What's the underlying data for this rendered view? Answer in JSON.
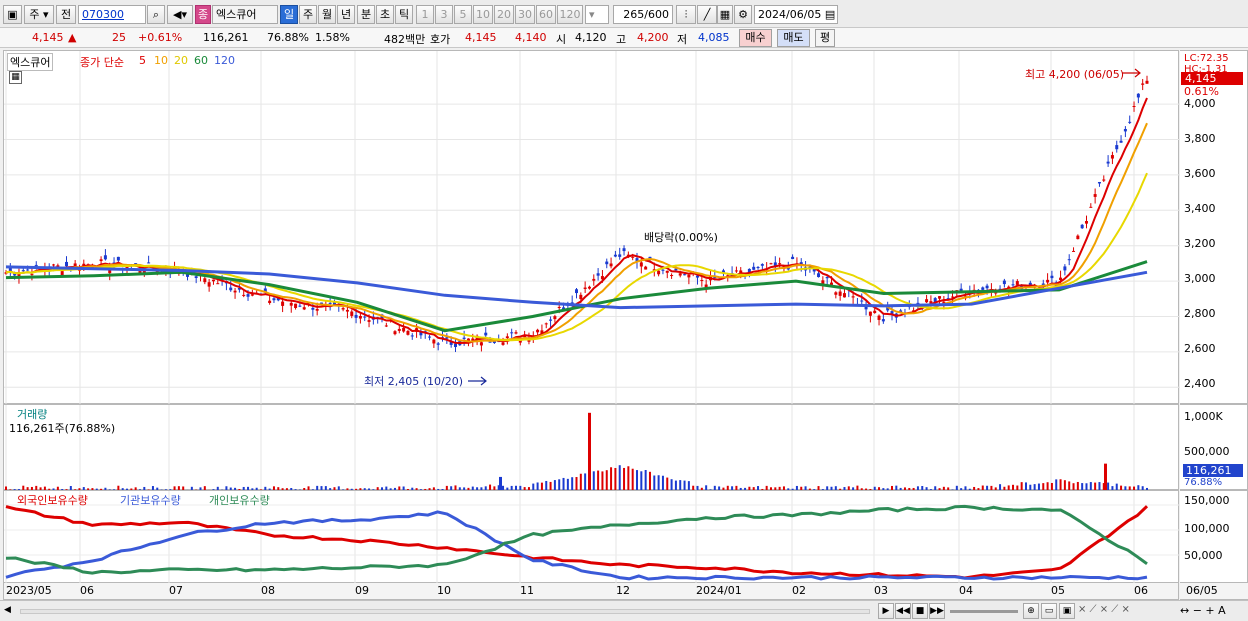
{
  "toolbar": {
    "mode1": "주",
    "mode2": "전",
    "code": "070300",
    "name": "엑스큐어",
    "name_badge": "종",
    "periods": [
      "일",
      "주",
      "월",
      "년",
      "분",
      "초",
      "틱"
    ],
    "intervals": [
      "1",
      "3",
      "5",
      "10",
      "20",
      "30",
      "60",
      "120"
    ],
    "count": "265",
    "count_total": "/600",
    "date": "2024/06/05"
  },
  "quote": {
    "price": "4,145",
    "arrow": "▲",
    "change": "25",
    "pct": "+0.61%",
    "volume": "116,261",
    "vol_ratio": "76.88%",
    "turnover": "1.58%",
    "value": "482백만",
    "hoga_label": "호가",
    "ask": "4,145",
    "bid": "4,140",
    "open_label": "시",
    "open": "4,120",
    "high_label": "고",
    "high": "4,200",
    "low_label": "저",
    "low": "4,085",
    "buy": "매수",
    "sell": "매도",
    "eval": "평"
  },
  "price_panel": {
    "name": "엑스큐어",
    "ma_label": "종가 단순",
    "ma_periods": [
      "5",
      "10",
      "20",
      "60",
      "120"
    ],
    "ma_colors": [
      "#dd0000",
      "#f0a000",
      "#e8d800",
      "#1a8a3a",
      "#3a5ad8"
    ],
    "high_note": "최고 4,200 (06/05)",
    "low_note": "최저 2,405 (10/20)",
    "div_note": "배당락(0.00%)",
    "lc": "LC:72.35",
    "hc": "HC:-1.31",
    "price_tag": "4,145",
    "pct_tag": "0.61%",
    "y_ticks": [
      "4,000",
      "3,800",
      "3,600",
      "3,400",
      "3,200",
      "3,000",
      "2,800",
      "2,600",
      "2,400"
    ]
  },
  "volume_panel": {
    "title": "거래량",
    "info": "116,261주(76.88%)",
    "y_ticks": [
      "1,000K",
      "500,000"
    ],
    "tag": "116,261",
    "tag2": "76.88%"
  },
  "holding_panel": {
    "s1": "외국인보유수량",
    "s2": "기관보유수량",
    "s3": "개인보유수량",
    "colors": [
      "#dd0000",
      "#3a5ad8",
      "#2e8b57"
    ],
    "y_ticks": [
      "150,000",
      "100,000",
      "50,000"
    ]
  },
  "x_axis": [
    "2023/05",
    "06",
    "07",
    "08",
    "09",
    "10",
    "11",
    "12",
    "2024/01",
    "02",
    "03",
    "04",
    "05",
    "06"
  ],
  "x_axis_right": "06/05",
  "chart_data": {
    "type": "line",
    "title": "엑스큐어 (070300)",
    "x": [
      "2023/05",
      "06",
      "07",
      "08",
      "09",
      "10",
      "11",
      "12",
      "2024/01",
      "02",
      "03",
      "04",
      "05",
      "06"
    ],
    "series": [
      {
        "name": "종가",
        "values": [
          3050,
          3100,
          3060,
          2900,
          2820,
          2650,
          2700,
          3150,
          3000,
          3100,
          2800,
          2950,
          3000,
          4145
        ]
      },
      {
        "name": "단순 60",
        "values": [
          3020,
          3030,
          3050,
          2980,
          2880,
          2720,
          2800,
          2900,
          2960,
          3000,
          2930,
          2940,
          2950,
          3110
        ]
      },
      {
        "name": "단순 120",
        "values": [
          3080,
          3070,
          3060,
          3040,
          2990,
          2920,
          2880,
          2850,
          2860,
          2870,
          2860,
          2870,
          2960,
          3050
        ]
      },
      {
        "name": "거래량",
        "values": [
          60000,
          70000,
          40000,
          60000,
          50000,
          65000,
          150000,
          1000000,
          60000,
          70000,
          80000,
          50000,
          350000,
          116261
        ]
      },
      {
        "name": "외국인보유수량",
        "values": [
          145000,
          110000,
          115000,
          90000,
          80000,
          65000,
          45000,
          30000,
          25000,
          15000,
          10000,
          6000,
          20000,
          145000
        ]
      },
      {
        "name": "기관보유수량",
        "values": [
          8000,
          40000,
          90000,
          115000,
          120000,
          135000,
          40000,
          5000,
          5000,
          5000,
          5000,
          5000,
          5000,
          5000
        ]
      },
      {
        "name": "개인보유수량",
        "values": [
          45000,
          15000,
          20000,
          20000,
          25000,
          30000,
          90000,
          110000,
          125000,
          130000,
          140000,
          145000,
          140000,
          35000
        ]
      }
    ],
    "ylim": [
      2300,
      4300
    ]
  }
}
